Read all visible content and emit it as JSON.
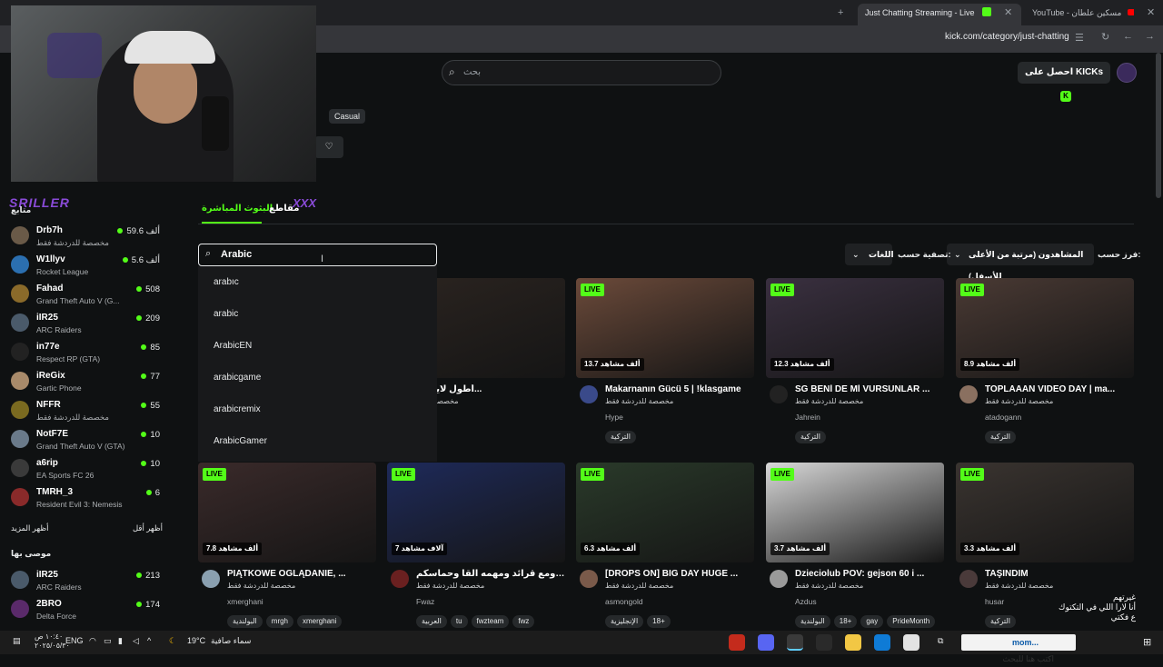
{
  "browser": {
    "tab_active": "Just Chatting Streaming - Live",
    "tab_youtube": "YouTube - مسكين علطان",
    "url": "kick.com/category/just-chatting"
  },
  "header": {
    "search_placeholder": "بحث",
    "kicks_button": "احصل على KICKs"
  },
  "overlay": {
    "streamer_tag": "SRILLER",
    "streamer_tag2": "XXX"
  },
  "category": {
    "tag": "Casual"
  },
  "sidebar": {
    "following_title": "متابع",
    "show_more": "أظهر المزيد",
    "show_less": "أظهر أقل",
    "recommended_title": "موصى بها",
    "following": [
      {
        "name": "Drb7h",
        "category": "مخصصة للدردشة فقط",
        "viewers": "59.6 ألف",
        "color": "#6a5a48"
      },
      {
        "name": "W1llyv",
        "category": "Rocket League",
        "viewers": "5.6 ألف",
        "color": "#2b6fb0"
      },
      {
        "name": "Fahad",
        "category": "Grand Theft Auto V (G...",
        "viewers": "508",
        "color": "#8a6a2a"
      },
      {
        "name": "iIR25",
        "category": "ARC Raiders",
        "viewers": "209",
        "color": "#4a5a6a"
      },
      {
        "name": "in77e",
        "category": "Respect RP (GTA)",
        "viewers": "85",
        "color": "#222"
      },
      {
        "name": "iReGix",
        "category": "Gartic Phone",
        "viewers": "77",
        "color": "#a88a6a"
      },
      {
        "name": "NFFR",
        "category": "مخصصة للدردشة فقط",
        "viewers": "55",
        "color": "#7a6a20"
      },
      {
        "name": "NotF7E",
        "category": "Grand Theft Auto V (GTA)",
        "viewers": "10",
        "color": "#6a7a8a"
      },
      {
        "name": "a6rip",
        "category": "EA Sports FC 26",
        "viewers": "10",
        "color": "#3a3a3a"
      },
      {
        "name": "TMRH_3",
        "category": "Resident Evil 3: Nemesis",
        "viewers": "6",
        "color": "#8a2a2a"
      }
    ],
    "recommended": [
      {
        "name": "iIR25",
        "category": "ARC Raiders",
        "viewers": "213",
        "color": "#4a5a6a"
      },
      {
        "name": "2BRO",
        "category": "Delta Force",
        "viewers": "174",
        "color": "#5a2a6a"
      }
    ]
  },
  "tabs": {
    "live": "البثوث المباشرة",
    "clips": "مقاطع"
  },
  "filters": {
    "search_value": "Arabic",
    "suggestions": [
      "arabıc",
      "arabic",
      "ArabicEN",
      "arabicgame",
      "arabicremix",
      "ArabicGamer"
    ],
    "sort_label": "فرز حسب:",
    "sort_value": "المشاهدون (مرتبة من الأعلى للأسفل)",
    "filter_label": "تصفية حسب:",
    "lang_value": "اللغات"
  },
  "cards_row1": [
    {
      "title": "أطول لايف با...",
      "subtitle": "مخصصة للدرد",
      "channel": "",
      "viewers": "",
      "tags": [],
      "thumb": "#2b2420",
      "live": false,
      "avatar": "#555"
    },
    {
      "title": "Makarnanın Gücü 5 | !klasgame",
      "subtitle": "مخصصة للدردشة فقط",
      "channel": "Hype",
      "viewers": "13.7 ألف مشاهد",
      "tags": [
        "التركية"
      ],
      "thumb": "#6b4a3a",
      "live": true,
      "avatar": "#3a4a8a"
    },
    {
      "title": "SG BENİ DE Mİ VURSUNLAR ...",
      "subtitle": "مخصصة للدردشة فقط",
      "channel": "Jahrein",
      "viewers": "12.3 ألف مشاهد",
      "tags": [
        "التركية"
      ],
      "thumb": "#3a3040",
      "live": true,
      "avatar": "#222"
    },
    {
      "title": "TOPLAAAN VIDEO DAY | ma...",
      "subtitle": "مخصصة للدردشة فقط",
      "channel": "atadogann",
      "viewers": "8.9 ألف مشاهد",
      "tags": [
        "التركية"
      ],
      "thumb": "#4a3a34",
      "live": true,
      "avatar": "#8a7060"
    }
  ],
  "cards_row2": [
    {
      "title": "PIĄTKOWE OGLĄDANIE, ...",
      "subtitle": "مخصصة للدردشة فقط",
      "channel": "xmerghani",
      "viewers": "7.8 ألف مشاهد",
      "tags": [
        "البولندية",
        "mrgh",
        "xmerghani"
      ],
      "thumb": "#3a2a2a",
      "live": true,
      "avatar": "#8aa0b0"
    },
    {
      "title": "ليق وصل ومع قرائد ومهمه القا وحماسكم...",
      "subtitle": "مخصصة للدردشة فقط",
      "channel": "Fwaz",
      "viewers": "7 آلاف مشاهد",
      "tags": [
        "العربية",
        "tu",
        "fwzteam",
        "fwz"
      ],
      "thumb": "#1e2a5a",
      "live": true,
      "avatar": "#6a2020"
    },
    {
      "title": "[DROPS ON] BIG DAY HUGE ...",
      "subtitle": "مخصصة للدردشة فقط",
      "channel": "asmongold",
      "viewers": "6.3 ألف مشاهد",
      "tags": [
        "الإنجليزية",
        "18+"
      ],
      "thumb": "#2a3a2a",
      "live": true,
      "avatar": "#7a5a4a"
    },
    {
      "title": "Dzieciolub POV: gejson 60 i ...",
      "subtitle": "مخصصة للدردشة فقط",
      "channel": "Azdus",
      "viewers": "3.7 ألف مشاهد",
      "tags": [
        "البولندية",
        "18+",
        "gay",
        "PrideMonth"
      ],
      "thumb": "#d8d8d8",
      "live": true,
      "avatar": "#9a9a9a"
    },
    {
      "title": "TAŞINDIM",
      "subtitle": "مخصصة للدردشة فقط",
      "channel": "husar",
      "viewers": "3.3 ألف مشاهد",
      "tags": [
        "التركية"
      ],
      "thumb": "#3a3430",
      "live": true,
      "avatar": "#4a3a3a"
    }
  ],
  "chat_overlay": {
    "line1": "غيرتهم",
    "line2": "أنا لارا اللي في التكتوك",
    "line3": "ع فكتي"
  },
  "taskbar": {
    "weather_temp": "19°C",
    "weather_text": "سماء صافية",
    "lang": "ENG",
    "time": "١٠:٤٠ ص",
    "date": "٢٠٢٥/٠٥/٣٠",
    "search_text": "اكتب هنا للبحث",
    "news_text": "mom..."
  }
}
